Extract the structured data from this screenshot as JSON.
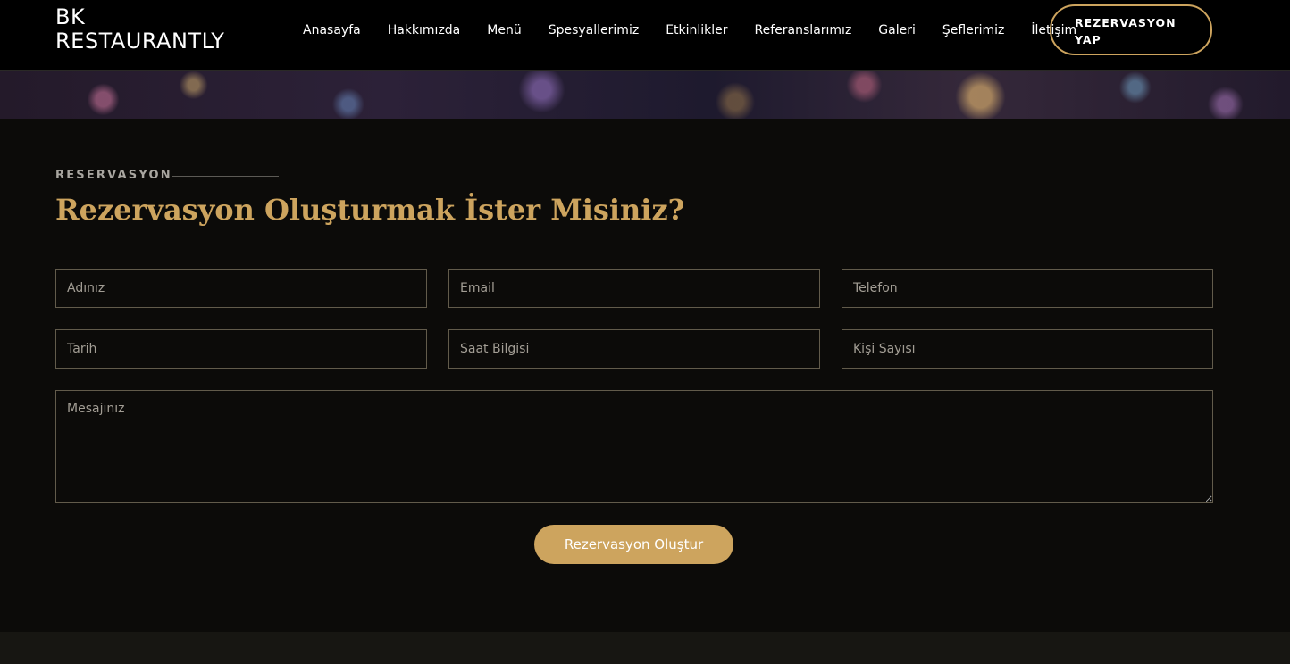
{
  "brand": {
    "logo_line1": "BK",
    "logo_line2": "RESTAURANTLY",
    "accent_color": "#cda45e"
  },
  "nav": {
    "items": [
      {
        "label": "Anasayfa"
      },
      {
        "label": "Hakkımızda"
      },
      {
        "label": "Menü"
      },
      {
        "label": "Spesyallerimiz"
      },
      {
        "label": "Etkinlikler"
      },
      {
        "label": "Referanslarımız"
      },
      {
        "label": "Galeri"
      },
      {
        "label": "Şeflerimiz"
      },
      {
        "label": "İletişim"
      }
    ],
    "book_button_line1": "REZERVASYON",
    "book_button_line2": "YAP"
  },
  "reservation": {
    "eyebrow": "RESERVASYON",
    "title": "Rezervasyon Oluşturmak İster Misiniz?",
    "fields": {
      "name_placeholder": "Adınız",
      "email_placeholder": "Email",
      "phone_placeholder": "Telefon",
      "date_placeholder": "Tarih",
      "time_placeholder": "Saat Bilgisi",
      "people_placeholder": "Kişi Sayısı",
      "message_placeholder": "Mesajınız"
    },
    "submit_label": "Rezervasyon Oluştur"
  }
}
